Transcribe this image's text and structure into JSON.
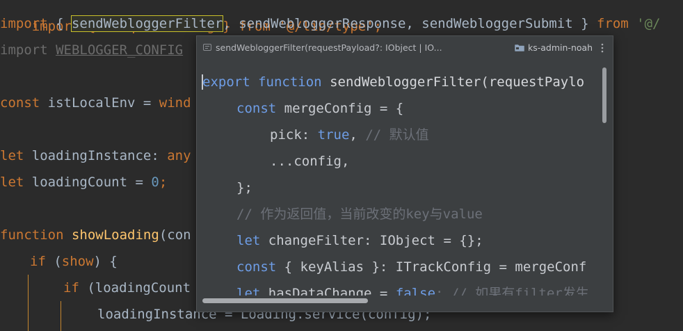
{
  "editor": {
    "line0_a": "import { IRequestConfig } from '@/lib/type';",
    "line1_import": "import",
    "line1_brace_open": " { ",
    "line1_highlight": "sendWebloggerFilter",
    "line1_rest": ", sendWebloggerResponse, sendWebloggerSubmit } ",
    "line1_from": "from",
    "line1_str": " '@/",
    "line2_import": "import",
    "line2_name": "WEBLOGGER_CONFIG",
    "line4_kw": "const",
    "line4_text": " istLocalEnv = ",
    "line4_tail": "wind",
    "line6_kw": "let",
    "line6_text": " loadingInstance: ",
    "line6_tail": "any",
    "line7_kw": "let",
    "line7_text": " loadingCount = ",
    "line7_num": "0",
    "line7_end": ";",
    "line9_kw": "function",
    "line9_fn": "showLoading",
    "line9_tail": "(con",
    "line10_kw": "if",
    "line10_a": " (",
    "line10_param": "show",
    "line10_b": ") {",
    "line11_kw": "if",
    "line11_text": " (loadingCount",
    "line12_text": "loadingInstance = Loading.service(config);"
  },
  "popup": {
    "title": "sendWebloggerFilter(requestPayload?: IObject | IO...",
    "module": "ks-admin-noah",
    "lines": {
      "l1_kw1": "export",
      "l1_kw2": "function",
      "l1_rest": "sendWebloggerFilter(requestPaylo",
      "l2_kw": "const",
      "l2_rest": "mergeConfig = {",
      "l3_key": "pick: ",
      "l3_val": "true",
      "l3_comma": ",",
      "l3_cm": "// 默认值",
      "l4": "...config,",
      "l5": "};",
      "l6_cm": "// 作为返回值，当前改变的key与value",
      "l7_kw": "let",
      "l7_rest": "changeFilter: IObject = {};",
      "l8_kw": "const",
      "l8_rest": "{ keyAlias }: ITrackConfig = mergeConf",
      "l9_kw": "let",
      "l9_rest": "hasDataChange = ",
      "l9_val": "false",
      "l9_cm": "; // 如果有filter发生"
    }
  },
  "icons": {
    "title_icon": "function-icon",
    "module_icon": "folder-icon",
    "menu_icon": "more-vertical-icon"
  },
  "colors": {
    "editor_bg": "#2b2b2b",
    "popup_bg": "#3c3f41",
    "keyword": "#cc7832",
    "popup_keyword": "#6e9de6",
    "string": "#6a8759",
    "number": "#6897bb",
    "function": "#ffc66d",
    "highlight_border": "#c9c12a"
  }
}
